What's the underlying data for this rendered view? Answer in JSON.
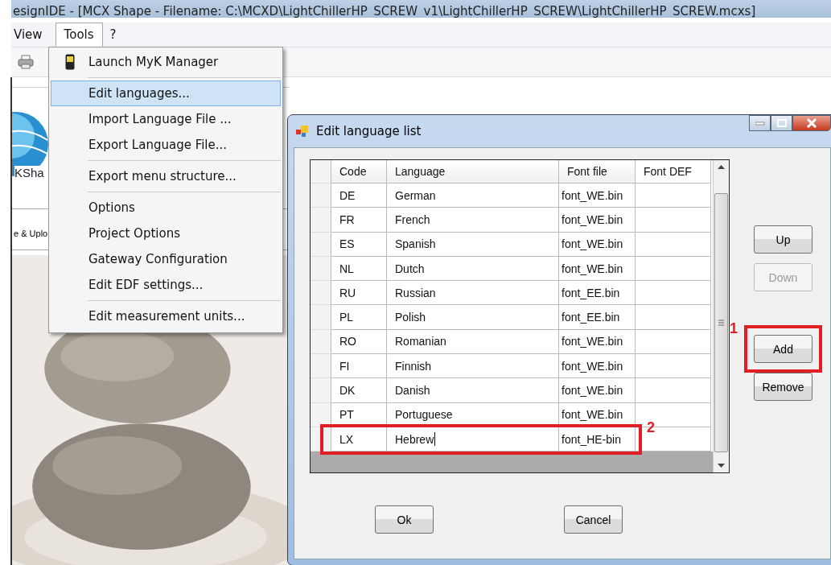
{
  "app": {
    "title": "esignIDE - [MCX Shape - Filename: C:\\MCXD\\LightChillerHP_SCREW_v1\\LightChillerHP_SCREW\\LightChillerHP_SCREW.mcxs]",
    "menu": [
      {
        "label": "View",
        "open": false
      },
      {
        "label": "Tools",
        "open": true
      },
      {
        "label": "?",
        "open": false
      }
    ],
    "logo_text": "KSha",
    "tab_text": "e & Uplo"
  },
  "tools_menu": {
    "items": [
      {
        "kind": "app",
        "label": "Launch MyK Manager",
        "selected": false
      },
      {
        "kind": "separator"
      },
      {
        "kind": "item",
        "label": "Edit languages...",
        "selected": true
      },
      {
        "kind": "item",
        "label": "Import Language File ...",
        "selected": false
      },
      {
        "kind": "item",
        "label": "Export Language File...",
        "selected": false
      },
      {
        "kind": "separator"
      },
      {
        "kind": "item",
        "label": "Export menu structure...",
        "selected": false
      },
      {
        "kind": "separator"
      },
      {
        "kind": "item",
        "label": "Options",
        "selected": false
      },
      {
        "kind": "item",
        "label": "Project Options",
        "selected": false
      },
      {
        "kind": "item",
        "label": "Gateway Configuration",
        "selected": false
      },
      {
        "kind": "item",
        "label": "Edit EDF settings...",
        "selected": false
      },
      {
        "kind": "separator"
      },
      {
        "kind": "item",
        "label": "Edit measurement units...",
        "selected": false
      }
    ]
  },
  "dialog": {
    "title": "Edit language list",
    "columns": [
      "Code",
      "Language",
      "Font file",
      "Font DEF"
    ],
    "rows": [
      {
        "code": "DE",
        "language": "German",
        "font_file": "font_WE.bin",
        "editing": false
      },
      {
        "code": "FR",
        "language": "French",
        "font_file": "font_WE.bin",
        "editing": false
      },
      {
        "code": "ES",
        "language": "Spanish",
        "font_file": "font_WE.bin",
        "editing": false
      },
      {
        "code": "NL",
        "language": "Dutch",
        "font_file": "font_WE.bin",
        "editing": false
      },
      {
        "code": "RU",
        "language": "Russian",
        "font_file": "font_EE.bin",
        "editing": false
      },
      {
        "code": "PL",
        "language": "Polish",
        "font_file": "font_EE.bin",
        "editing": false
      },
      {
        "code": "RO",
        "language": "Romanian",
        "font_file": "font_WE.bin",
        "editing": false
      },
      {
        "code": "FI",
        "language": "Finnish",
        "font_file": "font_WE.bin",
        "editing": false
      },
      {
        "code": "DK",
        "language": "Danish",
        "font_file": "font_WE.bin",
        "editing": false
      },
      {
        "code": "PT",
        "language": "Portuguese",
        "font_file": "font_WE.bin",
        "editing": false
      },
      {
        "code": "LX",
        "language": "Hebrew",
        "font_file": "font_HE-bin",
        "editing": true,
        "callout": "2"
      }
    ],
    "side_buttons": [
      {
        "label": "Up",
        "disabled": false
      },
      {
        "label": "Down",
        "disabled": true
      },
      {
        "label": "Add",
        "disabled": false,
        "callout": "1"
      },
      {
        "label": "Remove",
        "disabled": false
      }
    ],
    "footer_buttons": [
      "Ok",
      "Cancel"
    ]
  }
}
